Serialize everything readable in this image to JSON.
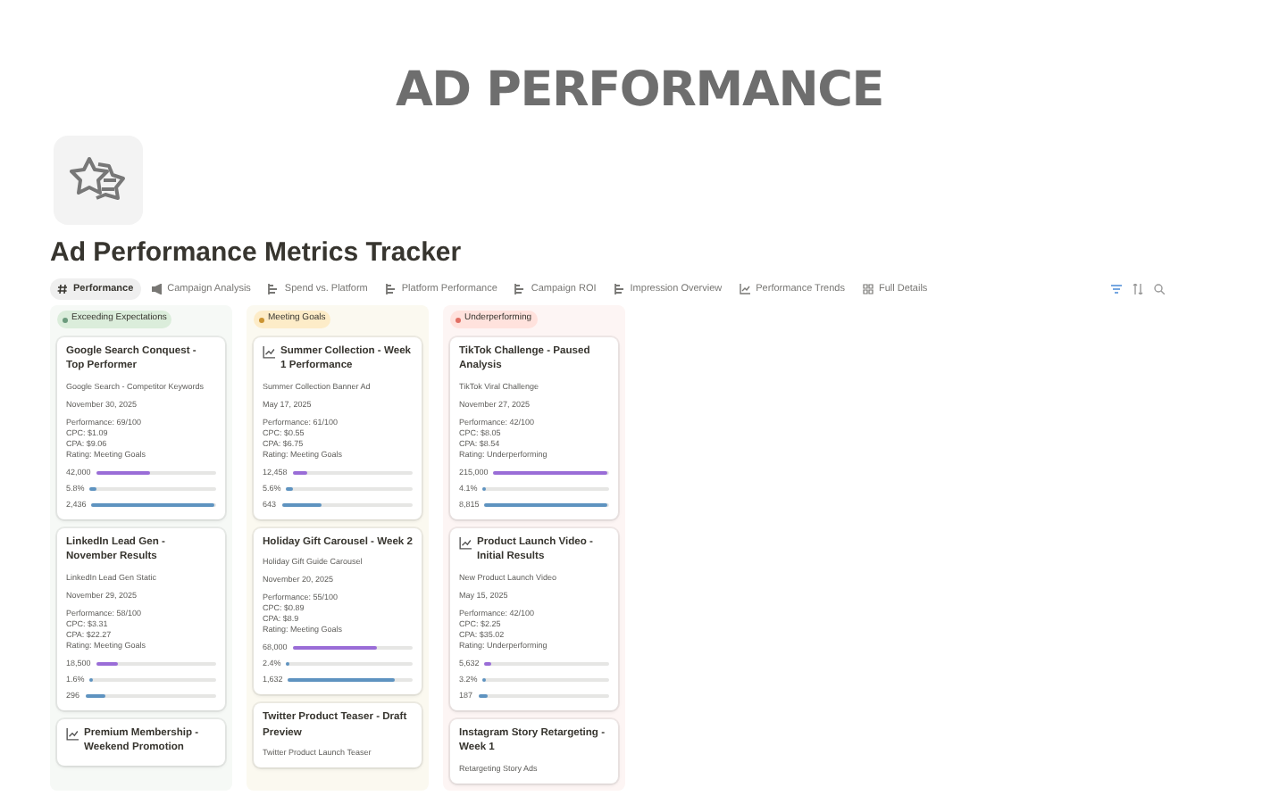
{
  "banner": "AD PERFORMANCE",
  "page_title": "Ad Performance Metrics Tracker",
  "tabs": [
    {
      "label": "Performance",
      "selected": true
    },
    {
      "label": "Campaign Analysis",
      "selected": false
    },
    {
      "label": "Spend vs. Platform",
      "selected": false
    },
    {
      "label": "Platform Performance",
      "selected": false
    },
    {
      "label": "Campaign ROI",
      "selected": false
    },
    {
      "label": "Impression Overview",
      "selected": false
    },
    {
      "label": "Performance Trends",
      "selected": false
    },
    {
      "label": "Full Details",
      "selected": false
    }
  ],
  "columns": [
    {
      "label": "Exceeding Expectations",
      "color": "#6c9b7d",
      "cards": [
        {
          "title": "Google Search Conquest - Top Performer",
          "has_icon": false,
          "ad": "Google Search - Competitor Keywords",
          "date": "November 30, 2025",
          "lines": [
            "Performance: 69/100",
            "CPC: $1.09",
            "CPA: $9.06",
            "Rating: Meeting Goals"
          ],
          "bars": [
            {
              "reading": "42,000",
              "level": 0.45
            },
            {
              "reading": "5.8%",
              "level": 0.05
            },
            {
              "reading": "2,436",
              "level": 1.0
            }
          ]
        },
        {
          "title": "LinkedIn Lead Gen - November Results",
          "has_icon": false,
          "ad": "LinkedIn Lead Gen Static",
          "date": "November 29, 2025",
          "lines": [
            "Performance: 58/100",
            "CPC: $3.31",
            "CPA: $22.27",
            "Rating: Meeting Goals"
          ],
          "bars": [
            {
              "reading": "18,500",
              "level": 0.18
            },
            {
              "reading": "1.6%",
              "level": 0.01
            },
            {
              "reading": "296",
              "level": 0.15
            }
          ]
        },
        {
          "title": "Premium Membership - Weekend Promotion",
          "has_icon": true
        }
      ]
    },
    {
      "label": "Meeting Goals",
      "color": "#cb9433",
      "cards": [
        {
          "title": "Summer Collection - Week 1 Performance",
          "has_icon": true,
          "ad": "Summer Collection Banner Ad",
          "date": "May 17, 2025",
          "lines": [
            "Performance: 61/100",
            "CPC: $0.55",
            "CPA: $6.75",
            "Rating: Meeting Goals"
          ],
          "bars": [
            {
              "reading": "12,458",
              "level": 0.12
            },
            {
              "reading": "5.6%",
              "level": 0.05
            },
            {
              "reading": "643",
              "level": 0.3
            }
          ]
        },
        {
          "title": "Holiday Gift Carousel - Week 2",
          "has_icon": false,
          "ad": "Holiday Gift Guide Carousel",
          "date": "November 20, 2025",
          "lines": [
            "Performance: 55/100",
            "CPC: $0.89",
            "CPA: $8.9",
            "Rating: Meeting Goals"
          ],
          "bars": [
            {
              "reading": "68,000",
              "level": 0.7
            },
            {
              "reading": "2.4%",
              "level": 0.01
            },
            {
              "reading": "1,632",
              "level": 0.85
            }
          ]
        },
        {
          "title": "Twitter Product Teaser - Draft Preview",
          "has_icon": false,
          "ad": "Twitter Product Launch Teaser"
        }
      ]
    },
    {
      "label": "Underperforming",
      "color": "#e16f64",
      "cards": [
        {
          "title": "TikTok Challenge - Paused Analysis",
          "has_icon": false,
          "ad": "TikTok Viral Challenge",
          "date": "November 27, 2025",
          "lines": [
            "Performance: 42/100",
            "CPC: $8.05",
            "CPA: $8.54",
            "Rating: Underperforming"
          ],
          "bars": [
            {
              "reading": "215,000",
              "level": 1.0
            },
            {
              "reading": "4.1%",
              "level": 0.03
            },
            {
              "reading": "8,815",
              "level": 1.0
            }
          ]
        },
        {
          "title": "Product Launch Video - Initial Results",
          "has_icon": true,
          "ad": "New Product Launch Video",
          "date": "May 15, 2025",
          "lines": [
            "Performance: 42/100",
            "CPC: $2.25",
            "CPA: $35.02",
            "Rating: Underperforming"
          ],
          "bars": [
            {
              "reading": "5,632",
              "level": 0.05
            },
            {
              "reading": "3.2%",
              "level": 0.03
            },
            {
              "reading": "187",
              "level": 0.08
            }
          ]
        },
        {
          "title": "Instagram Story Retargeting - Week 1",
          "has_icon": false,
          "ad": "Retargeting Story Ads"
        }
      ]
    }
  ]
}
